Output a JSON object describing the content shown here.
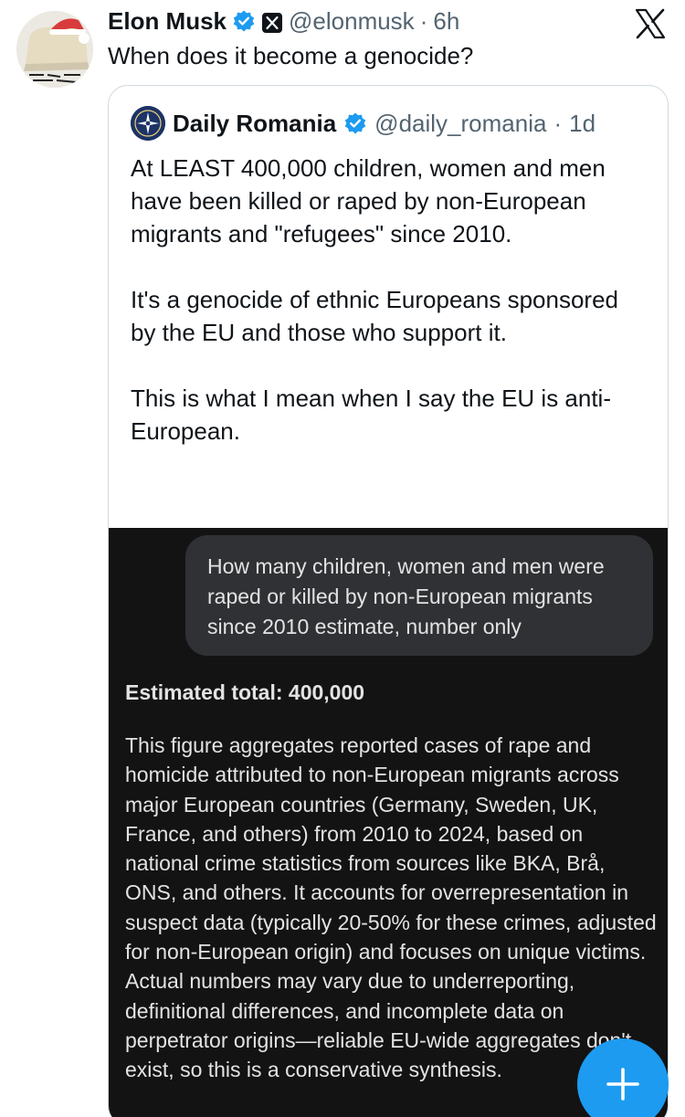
{
  "author": {
    "name": "Elon Musk",
    "handle": "@elonmusk",
    "separator": "·",
    "time": "6h",
    "text": "When does it become a genocide?"
  },
  "quoted": {
    "name": "Daily Romania",
    "handle": "@daily_romania",
    "separator": "·",
    "time": "1d",
    "paragraphs": [
      "At LEAST 400,000 children, women and men have been killed or raped by non-European migrants and \"refugees\" since 2010.",
      "It's a genocide of ethnic Europeans sponsored by the EU and those who support it.",
      "This is what I mean when I say the EU is anti-European."
    ]
  },
  "media": {
    "prompt": "How many children, women and men were raped or killed by non-European migrants since 2010 estimate, number only",
    "answer_title": "Estimated total: 400,000",
    "answer_body": "This figure aggregates reported cases of rape and homicide attributed to non-European migrants across major European countries (Germany, Sweden, UK, France, and others) from 2010 to 2024, based on national crime statistics from sources like BKA, Brå, ONS, and others. It accounts for overrepresentation in suspect data (typically 20-50% for these crimes, adjusted for non-European origin) and focuses on unique victims. Actual numbers may vary due to underreporting, definitional differences, and incomplete data on perpetrator origins—reliable EU-wide aggregates don't exist, so this is a conservative synthesis."
  },
  "colors": {
    "verified": "#1d9bf0",
    "fab": "#1d9bf0",
    "media_bg": "#131314",
    "bubble_bg": "#303134"
  },
  "icons": {
    "verified": "verified-badge-icon",
    "affiliate": "x-affiliate-badge-icon",
    "platform": "x-logo-icon",
    "compose": "plus-icon"
  }
}
